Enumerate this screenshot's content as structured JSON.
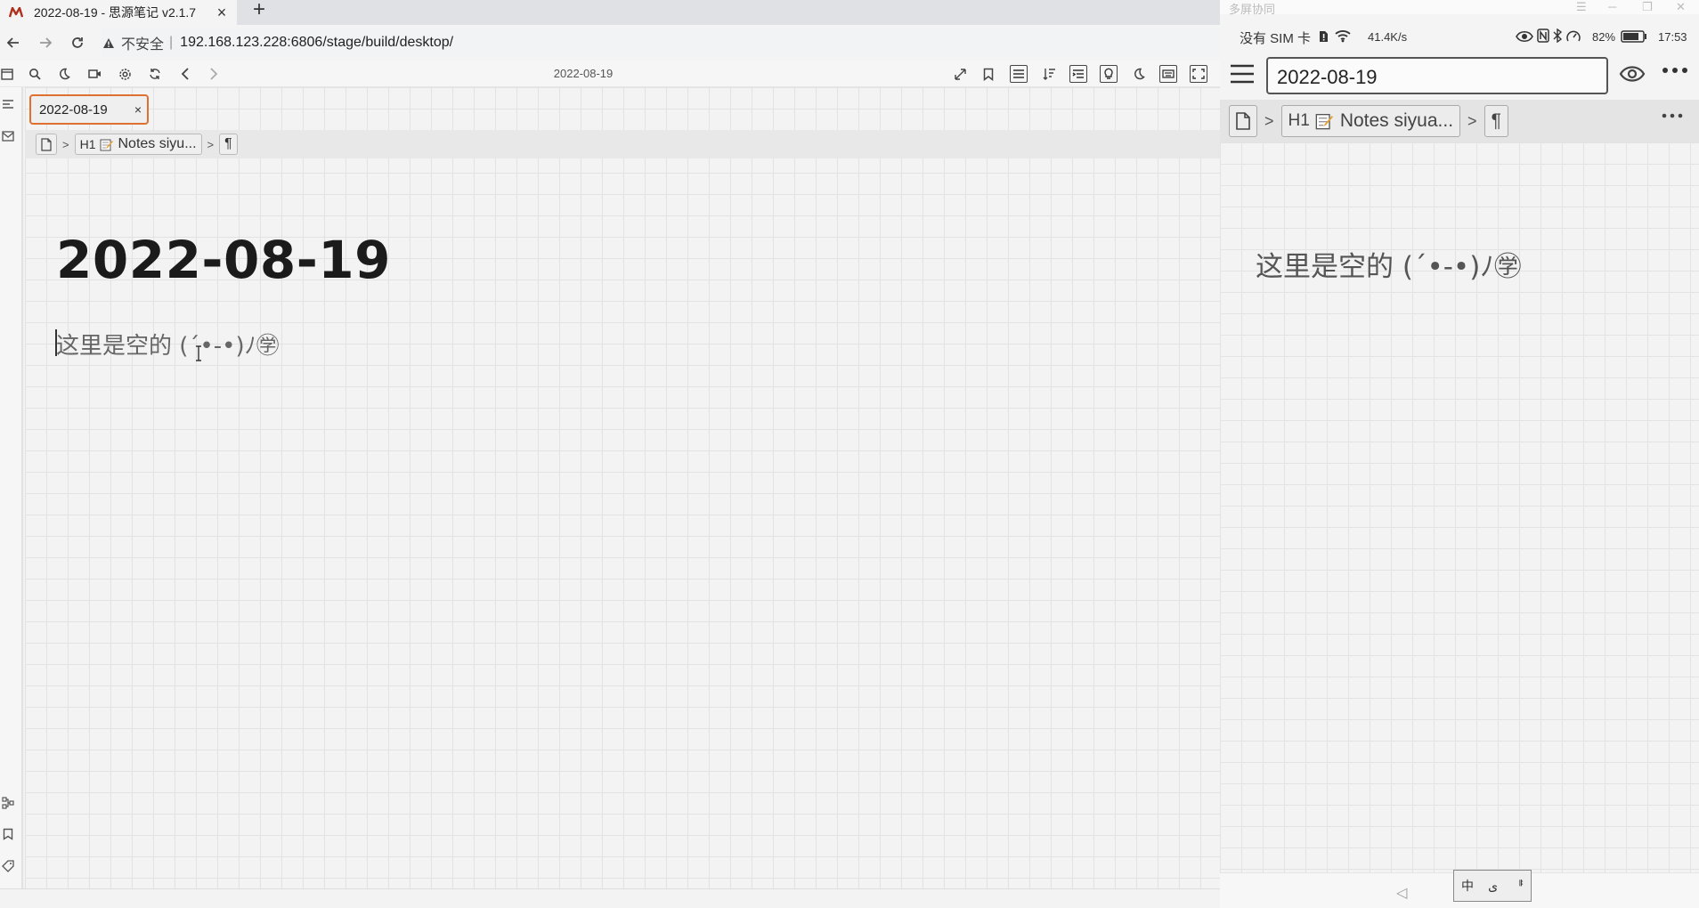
{
  "browser": {
    "tab_title": "2022-08-19 - 思源笔记 v2.1.7",
    "tab_close": "×",
    "new_tab": "+",
    "insecure_label": "不安全",
    "separator": "|",
    "url": "192.168.123.228:6806/stage/build/desktop/"
  },
  "siyuan": {
    "toolbar_title": "2022-08-19",
    "doc_tab_label": "2022-08-19",
    "doc_tab_close": "×",
    "breadcrumb": {
      "heading_tag": "H1",
      "notebook_label": "Notes siyu...",
      "paragraph_mark": "¶"
    },
    "doc_title": "2022-08-19",
    "empty_placeholder": "这里是空的 (´•-•)ﾉ㊫"
  },
  "phone": {
    "window_name": "多屏协同",
    "carrier": "没有 SIM 卡",
    "net_speed": "41.4K/s",
    "battery": "82%",
    "time": "17:53",
    "search_value": "2022-08-19",
    "breadcrumb": {
      "heading_tag": "H1",
      "notebook_label": "Notes siyua...",
      "paragraph_mark": "¶"
    },
    "empty_placeholder": "这里是空的 (´•-•)ﾉ㊫",
    "nav_back": "◁",
    "ime_keys": [
      "中",
      "ى",
      "ᆙ"
    ]
  },
  "colors": {
    "active_tab_border": "#e07030",
    "grid_line": "#e2e2e2",
    "title_text": "#1b1b1b"
  },
  "icons": {
    "browser": [
      "siyuan-favicon",
      "back-icon",
      "forward-icon",
      "reload-icon",
      "warning-icon"
    ],
    "toolbar_left": [
      "calendar-icon",
      "search-icon",
      "moon-icon",
      "video-icon",
      "gear-icon",
      "sync-icon",
      "chevron-left-icon",
      "chevron-right-icon"
    ],
    "toolbar_right": [
      "collapse-icon",
      "bookmark-icon",
      "list-icon",
      "sort-icon",
      "outline-icon",
      "lightbulb-icon",
      "moon-icon",
      "keyboard-icon",
      "fullscreen-icon"
    ]
  }
}
